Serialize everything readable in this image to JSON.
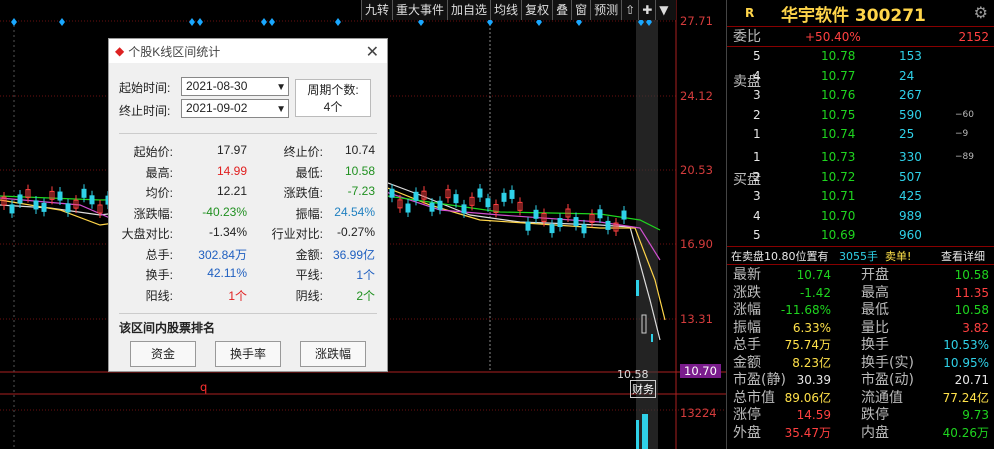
{
  "toolbar": [
    "九转",
    "重大事件",
    "加自选",
    "均线",
    "复权",
    "叠",
    "窗",
    "预测",
    "⇧",
    "✚",
    "▼"
  ],
  "price_axis": [
    "27.71",
    "24.12",
    "20.53",
    "16.90",
    "13.31",
    "10.70"
  ],
  "volume_label": "13224",
  "chart_labels": {
    "q": "q",
    "tag": "财务",
    "cur": "10.58"
  },
  "dialog": {
    "title": "个股K线区间统计",
    "start_label": "起始时间:",
    "start": "2021-08-30",
    "end_label": "终止时间:",
    "end": "2021-09-02",
    "period_label": "周期个数:",
    "period": "4个",
    "stats": [
      [
        "起始价:",
        "17.97",
        "终止价:",
        "10.74"
      ],
      [
        "最高:",
        "14.99",
        "最低:",
        "10.58"
      ],
      [
        "均价:",
        "12.21",
        "涨跌值:",
        "-7.23"
      ],
      [
        "涨跌幅:",
        "-40.23%",
        "振幅:",
        "24.54%"
      ],
      [
        "大盘对比:",
        "-1.34%",
        "行业对比:",
        "-0.27%"
      ],
      [
        "总手:",
        "302.84万",
        "金额:",
        "36.99亿"
      ],
      [
        "换手:",
        "42.11%",
        "平线:",
        "1个"
      ],
      [
        "阳线:",
        "1个",
        "阴线:",
        "2个"
      ]
    ],
    "rank_title": "该区间内股票排名",
    "btns": [
      "资金",
      "换手率",
      "涨跌幅"
    ]
  },
  "quote": {
    "r": "R",
    "name": "华宇软件 300271",
    "wb_label": "委比",
    "wb": "+50.40%",
    "wb_num": "2152",
    "sell_label": "卖盘",
    "buy_label": "买盘",
    "sell": [
      [
        "5",
        "10.78",
        "153",
        ""
      ],
      [
        "4",
        "10.77",
        "24",
        ""
      ],
      [
        "3",
        "10.76",
        "267",
        ""
      ],
      [
        "2",
        "10.75",
        "590",
        "−60"
      ],
      [
        "1",
        "10.74",
        "25",
        "−9"
      ]
    ],
    "buy": [
      [
        "1",
        "10.73",
        "330",
        "−89"
      ],
      [
        "2",
        "10.72",
        "507",
        ""
      ],
      [
        "3",
        "10.71",
        "425",
        ""
      ],
      [
        "4",
        "10.70",
        "989",
        ""
      ],
      [
        "5",
        "10.69",
        "960",
        ""
      ]
    ],
    "notice": "在卖盘10.80位置有",
    "notice_n": "3055手",
    "notice_t": "卖单!",
    "detail": "查看详细",
    "info": [
      [
        "最新",
        "10.74",
        "开盘",
        "10.58"
      ],
      [
        "涨跌",
        "-1.42",
        "最高",
        "11.35"
      ],
      [
        "涨幅",
        "-11.68%",
        "最低",
        "10.58"
      ],
      [
        "振幅",
        "6.33%",
        "量比",
        "3.82"
      ],
      [
        "总手",
        "75.74万",
        "换手",
        "10.53%"
      ],
      [
        "金额",
        "8.23亿",
        "换手(实)",
        "10.95%"
      ],
      [
        "市盈(静)",
        "30.39",
        "市盈(动)",
        "20.71"
      ],
      [
        "总市值",
        "89.06亿",
        "流通值",
        "77.24亿"
      ],
      [
        "涨停",
        "14.59",
        "跌停",
        "9.73"
      ],
      [
        "外盘",
        "35.47万",
        "内盘",
        "40.26万"
      ]
    ]
  },
  "colors": {
    "up": "#ff4040",
    "down": "#1fd51f",
    "accent": "#ffd54a"
  }
}
